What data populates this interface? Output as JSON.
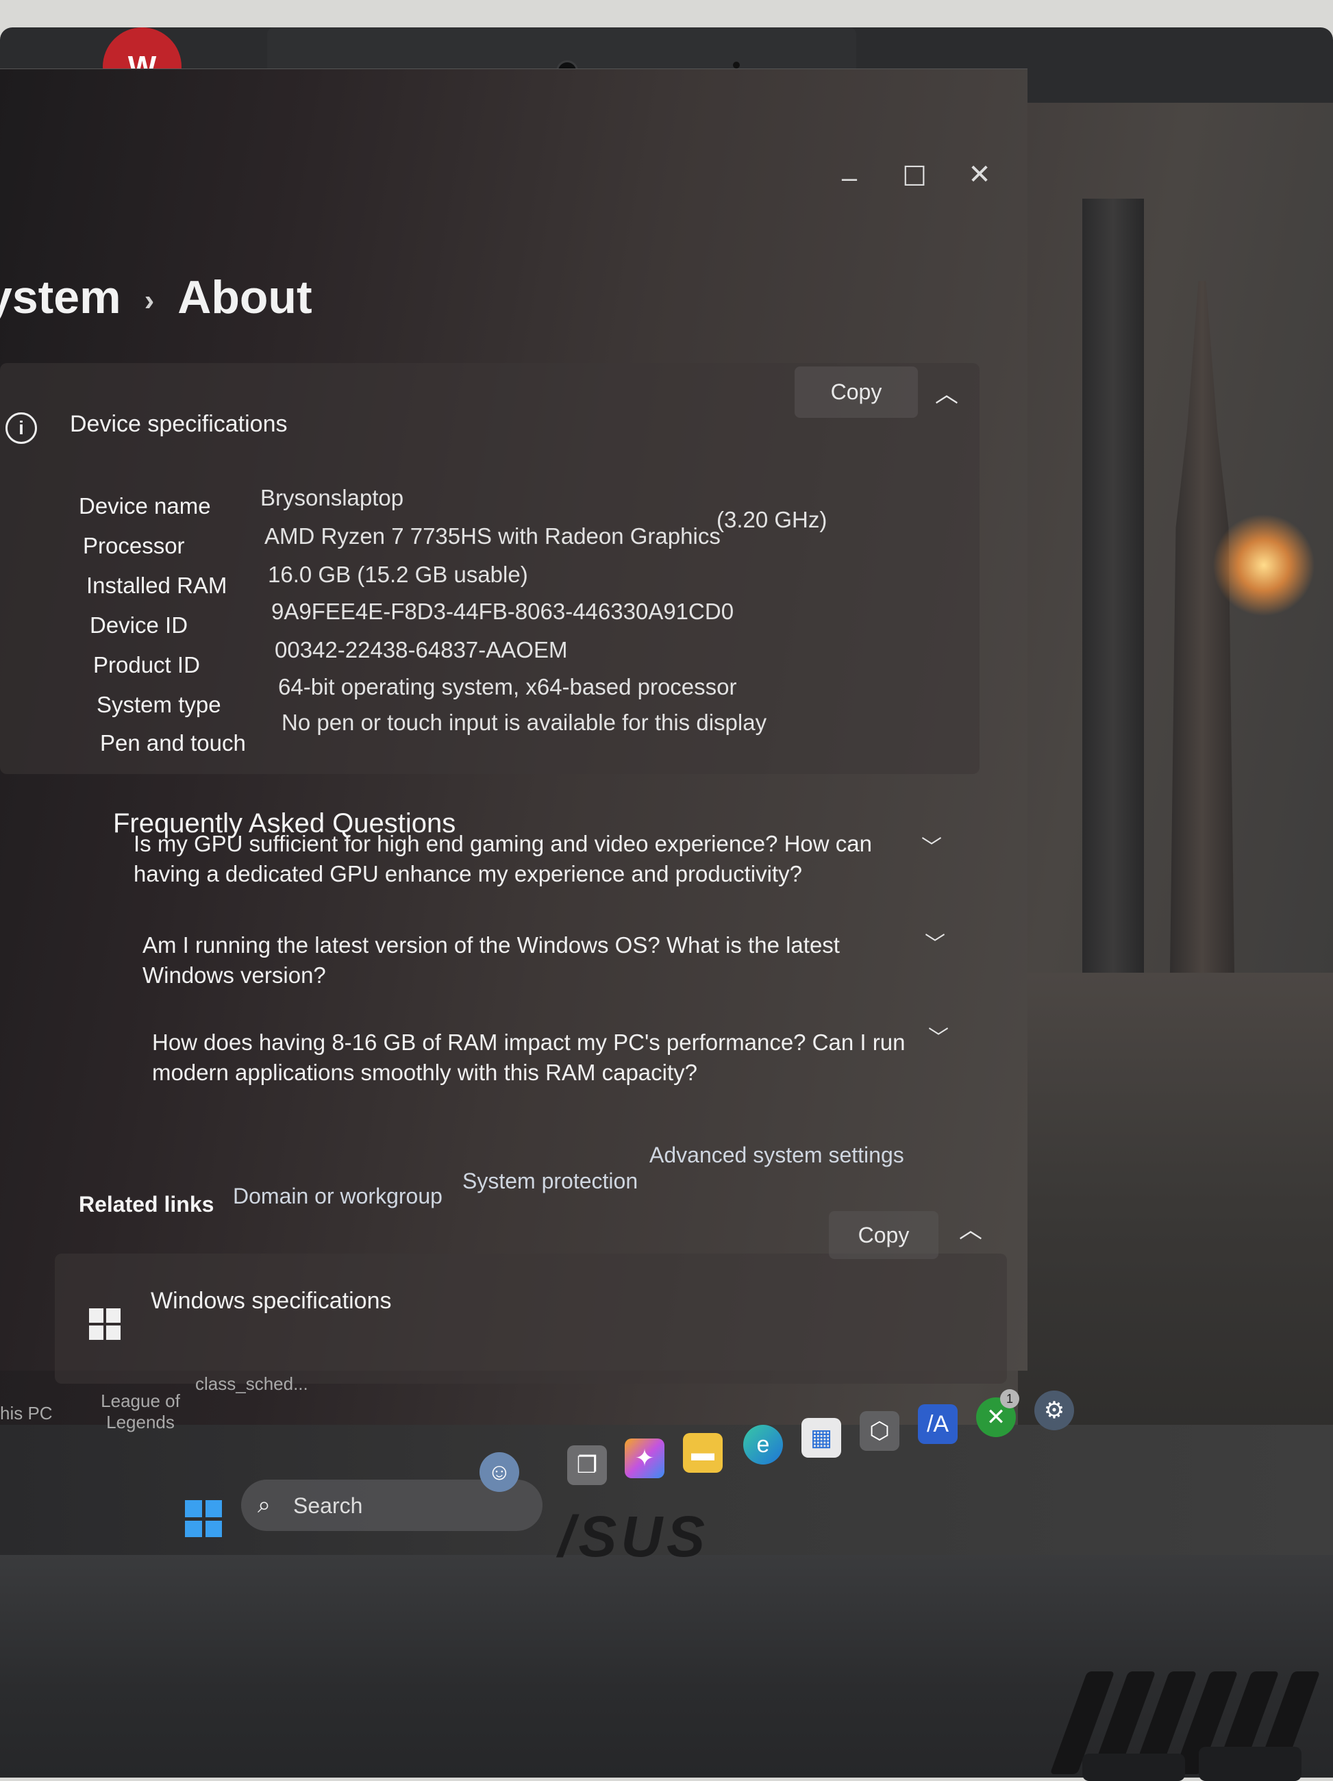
{
  "window": {
    "breadcrumb_parent": "ystem",
    "breadcrumb_separator": "›",
    "title": "About",
    "controls": {
      "minimize": "–",
      "maximize": "☐",
      "close": "✕"
    }
  },
  "device_specs": {
    "heading": "Device specifications",
    "copy_label": "Copy",
    "rows": [
      {
        "label": "Device name",
        "value": "Brysonslaptop"
      },
      {
        "label": "Processor",
        "value": "AMD Ryzen 7 7735HS with Radeon Graphics",
        "extra": "(3.20 GHz)"
      },
      {
        "label": "Installed RAM",
        "value": "16.0 GB (15.2 GB usable)"
      },
      {
        "label": "Device ID",
        "value": "9A9FEE4E-F8D3-44FB-8063-446330A91CD0"
      },
      {
        "label": "Product ID",
        "value": "00342-22438-64837-AAOEM"
      },
      {
        "label": "System type",
        "value": "64-bit operating system, x64-based processor"
      },
      {
        "label": "Pen and touch",
        "value": "No pen or touch input is available for this display"
      }
    ]
  },
  "faq": {
    "title": "Frequently Asked Questions",
    "items": [
      "Is my GPU sufficient for high end gaming and video experience? How can having a dedicated GPU enhance my experience and productivity?",
      "Am I running the latest version of the Windows OS? What is the latest Windows version?",
      "How does having 8-16 GB of RAM impact my PC's performance? Can I run modern applications smoothly with this RAM capacity?"
    ]
  },
  "related_links": {
    "label": "Related links",
    "links": [
      "Domain or workgroup",
      "System protection",
      "Advanced system settings"
    ]
  },
  "windows_specs": {
    "heading": "Windows specifications",
    "copy_label": "Copy"
  },
  "desktop": {
    "items": [
      "his PC",
      "League of Legends",
      "class_sched..."
    ]
  },
  "taskbar": {
    "search_placeholder": "Search",
    "xbox_badge": "1"
  },
  "hardware": {
    "brand": "/SUS"
  }
}
